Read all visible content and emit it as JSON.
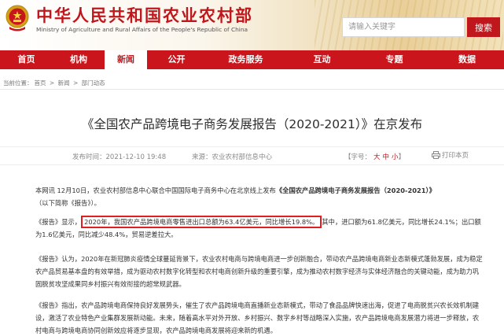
{
  "header": {
    "site_title": "中华人民共和国农业农村部",
    "site_subtitle": "Ministry of Agriculture and Rural Affairs of the People's Republic of China",
    "search_placeholder": "请输入关键字",
    "search_button": "搜索",
    "brand_color": "#c0171d"
  },
  "nav": {
    "items": [
      {
        "label": "首页"
      },
      {
        "label": "机构"
      },
      {
        "label": "新闻",
        "active": true
      },
      {
        "label": "公开"
      },
      {
        "label": "政务服务"
      },
      {
        "label": "互动"
      },
      {
        "label": "专题"
      },
      {
        "label": "数据"
      }
    ]
  },
  "breadcrumb": {
    "prefix": "当前位置：",
    "items": [
      "首页",
      "新闻",
      "部门动态"
    ],
    "separator": ">"
  },
  "article": {
    "title": "《全国农产品跨境电子商务发展报告（2020-2021）》在京发布",
    "date": "发布时间：2021-12-10 19:48",
    "source": "来源：农业农村部信息中心",
    "font_size_label": "【字号：",
    "font_size_options": [
      "大",
      "中",
      "小"
    ],
    "font_size_close": "】",
    "print_label": "打印本页",
    "paragraphs": {
      "p1_a": "本网讯 12月10日，农业农村部信息中心联合中国国际电子商务中心在北京线上发布",
      "p1_b": "《全国农产品跨境电子商务发展报告（2020-2021）》",
      "p1_c": "（以下简称《报告》）。",
      "p2_a": "《报告》显示，",
      "p2_hl": "2020年，我国农产品跨境电商零售进出口总额为63.4亿美元，同比增长19.8%。",
      "p2_b": "其中，进口额为61.8亿美元，同比增长24.1%；出口额为1.6亿美元，同比减少48.4%，贸易逆差拉大。",
      "p3": "《报告》认为，2020年在新冠肺炎疫情全球蔓延背景下，农业农村电商与跨境电商进一步创新融合，带动农产品跨境电商新业态新模式蓬勃发展，成为稳定农产品贸易基本盘的有效举措，成为驱动农村数字化转型和农村电商创新升级的重要引擎，成为推动农村数字经济与实体经济融合的关键动能，成为助力巩固脱贫攻坚成果同乡村振兴有效衔接的超常规武器。",
      "p4": "《报告》指出，农产品跨境电商保持良好发展势头，催生了农产品跨境电商直播新业态新模式，带动了食品品牌快速出海，促进了电商脱贫兴农长效机制建设，激活了农业特色产业集群发展新动能。未来，随着高水平对外开放、乡村振兴、数字乡村等战略深入实施，农产品跨境电商发展潜力将进一步释放，农村电商与跨境电商协同创新效应将逐步显现，农产品跨境电商发展将迎来新的机遇。"
    },
    "highlight_color": "#e02020"
  }
}
